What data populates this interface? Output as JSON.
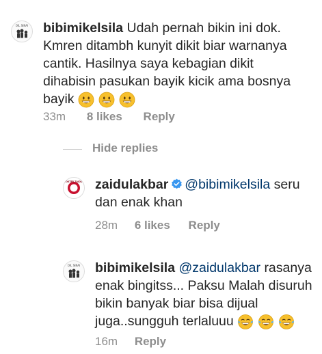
{
  "comments": [
    {
      "username": "bibimikelsila",
      "text_lines": [
        "Udah pernah bikin ini dok.",
        "Kmren ditambh kunyit dikit biar warnanya",
        "cantik. Hasilnya saya kebagian dikit",
        "dihabisin pasukan bayik kicik ama bosnya",
        "bayik"
      ],
      "emoji": [
        "grinning-face-emoji",
        "grinning-face-emoji",
        "grinning-face-emoji"
      ],
      "time": "33m",
      "likes": "8 likes",
      "reply": "Reply"
    }
  ],
  "hide_replies": "Hide replies",
  "replies": [
    {
      "username": "zaidulakbar",
      "verified": true,
      "mention": "@bibimikelsila",
      "text_lines": [
        "seru",
        "dan enak khan"
      ],
      "time": "28m",
      "likes": "6 likes",
      "reply": "Reply"
    },
    {
      "username": "bibimikelsila",
      "mention": "@zaidulakbar",
      "text_lines": [
        "rasanya",
        "enak bingitss... Paksu Malah disuruh",
        "bikin banyak biar bisa dijual",
        "juga..sungguh terlaluuu"
      ],
      "emoji": [
        "tears-of-joy-emoji",
        "tears-of-joy-emoji",
        "tears-of-joy-emoji"
      ],
      "time": "16m",
      "reply": "Reply"
    }
  ],
  "colors": {
    "text": "#262626",
    "meta": "#8e8e8e",
    "mention": "#00376b",
    "verified": "#3897f0",
    "emoji": "#f7c02d"
  },
  "avatar_labels": {
    "bibimikelsila": "OIL SINAI",
    "zaidulakbar": "DOKTER ZAIDUL"
  }
}
